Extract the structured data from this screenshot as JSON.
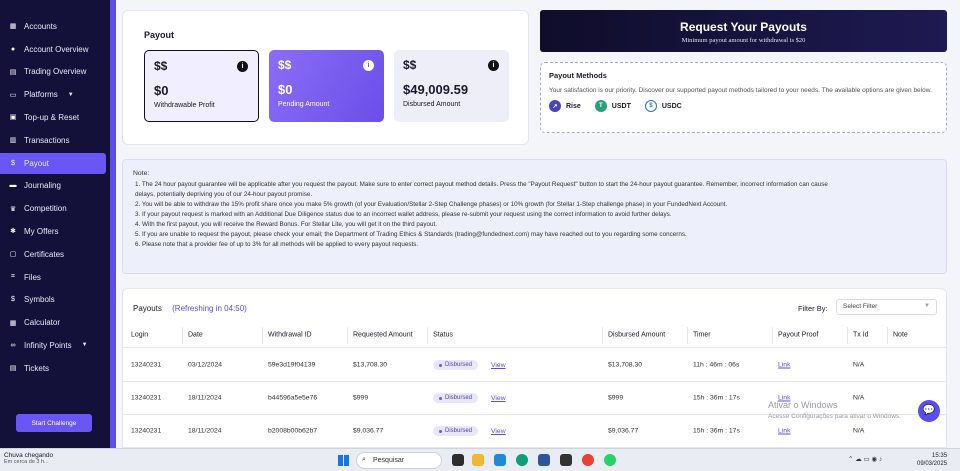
{
  "sidebar": {
    "items": [
      {
        "label": "Accounts",
        "icon": "grid-icon"
      },
      {
        "label": "Account Overview",
        "icon": "user-icon"
      },
      {
        "label": "Trading Overview",
        "icon": "chart-icon"
      },
      {
        "label": "Platforms",
        "icon": "monitor-icon",
        "has_chevron": true
      },
      {
        "label": "Top-up & Reset",
        "icon": "topup-icon"
      },
      {
        "label": "Transactions",
        "icon": "transactions-icon"
      },
      {
        "label": "Payout",
        "icon": "payout-icon",
        "active": true
      },
      {
        "label": "Journaling",
        "icon": "journal-icon"
      },
      {
        "label": "Competition",
        "icon": "trophy-icon"
      },
      {
        "label": "My Offers",
        "icon": "offers-icon"
      },
      {
        "label": "Certificates",
        "icon": "certificate-icon"
      },
      {
        "label": "Files",
        "icon": "files-icon"
      },
      {
        "label": "Symbols",
        "icon": "dollar-icon"
      },
      {
        "label": "Calculator",
        "icon": "calculator-icon"
      },
      {
        "label": "Infinity Points",
        "icon": "infinity-icon",
        "has_chevron": true
      },
      {
        "label": "Tickets",
        "icon": "ticket-icon"
      }
    ],
    "start_button": "Start Challenge"
  },
  "payout": {
    "title": "Payout",
    "stats": [
      {
        "value": "$0",
        "label": "Withdrawable Profit"
      },
      {
        "value": "$0",
        "label": "Pending Amount"
      },
      {
        "value": "$49,009.59",
        "label": "Disbursed Amount"
      }
    ]
  },
  "request": {
    "title": "Request Your Payouts",
    "subtitle": "Minimum payout amount for withdrawal is $20"
  },
  "methods": {
    "title": "Payout Methods",
    "description": "Your satisfaction is our priority. Discover our supported payout methods tailored to your needs. The available options are given below.",
    "items": [
      "Rise",
      "USDT",
      "USDC"
    ]
  },
  "notes": {
    "title": "Note:",
    "lines": [
      "1.  The 24 hour payout guarantee will be applicable after you request the payout. Make sure to enter correct payout method details. Press the \"Payout Request\" button to start the 24-hour payout guarantee. Remember, incorrect information can cause",
      "     delays, potentially depriving you of our 24-hour payout promise.",
      "2.  You will be able to withdraw the 15% profit share once you make 5% growth (of your Evaluation/Stellar 2-Step Challenge phases) or 10% growth (for Stellar 1-Step challenge phase) in your FundedNext Account.",
      "3.  If your payout request is marked with an Additional Due Diligence status due to an incorrect wallet address, please re-submit your request using the correct information to avoid further delays.",
      "4.  With the first payout, you will receive the Reward Bonus. For Stellar Lite, you will get it on the third payout.",
      "5.  If you are unable to request the payout, please check your email; the Department of Trading Ethics & Standards (trading@fundednext.com) may have reached out to you regarding some concerns.",
      "6.  Please note that a provider fee of up to 3% for all methods will be applied to every payout requests."
    ]
  },
  "table": {
    "title": "Payouts",
    "refresh": "(Refreshing in 04:50)",
    "filter_label": "Filter By:",
    "filter_placeholder": "Select Filter",
    "columns": [
      "Login",
      "Date",
      "Withdrawal ID",
      "Requested Amount",
      "Status",
      "Disbursed Amount",
      "Timer",
      "Payout Proof",
      "Tx Id",
      "Note"
    ],
    "rows": [
      {
        "login": "13240231",
        "date": "03/12/2024",
        "wid": "59e3d19f04139",
        "requested": "$13,708.30",
        "status": "Disbursed",
        "view": "View",
        "disbursed": "$13,708.30",
        "timer": "11h : 46m : 06s",
        "proof": "Link",
        "txid": "N/A"
      },
      {
        "login": "13240231",
        "date": "18/11/2024",
        "wid": "b44596a5e5e76",
        "requested": "$999",
        "status": "Disbursed",
        "view": "View",
        "disbursed": "$999",
        "timer": "15h : 36m : 17s",
        "proof": "Link",
        "txid": "N/A"
      },
      {
        "login": "13240231",
        "date": "18/11/2024",
        "wid": "b2008b00b62b7",
        "requested": "$9,036.77",
        "status": "Disbursed",
        "view": "View",
        "disbursed": "$9,036.77",
        "timer": "15h : 36m : 17s",
        "proof": "Link",
        "txid": "N/A"
      }
    ]
  },
  "watermark": {
    "line1": "Ativar o Windows",
    "line2": "Acesse Configurações para ativar o Windows."
  },
  "taskbar": {
    "weather_title": "Chuva chegando",
    "weather_sub": "Em cerca de 3 h...",
    "search": "Pesquisar",
    "time": "15:35",
    "date": "09/03/2025"
  },
  "colors": {
    "accent": "#6a55f5",
    "sidebar": "#13113a"
  }
}
